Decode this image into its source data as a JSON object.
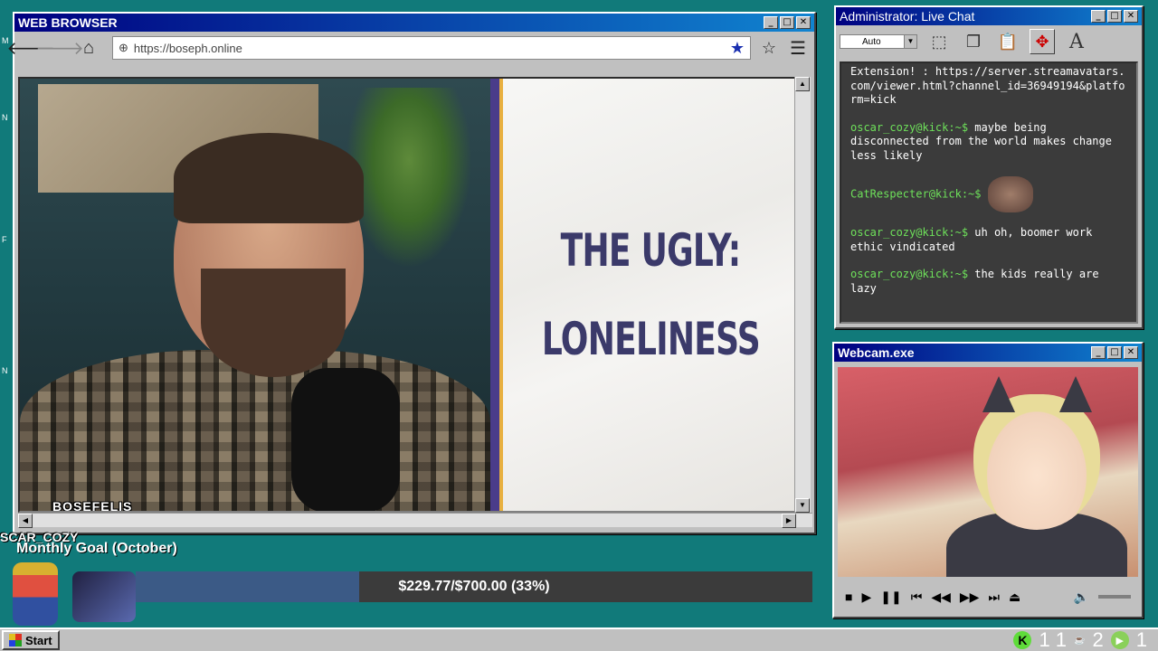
{
  "browser": {
    "title": "WEB BROWSER",
    "url": "https://boseph.online",
    "video": {
      "slide_line1": "THE UGLY:",
      "slide_line2": "LONELINESS",
      "overlay_name": "BOSEFELIS"
    }
  },
  "chat": {
    "title": "Administrator: Live Chat",
    "font_select": "Auto",
    "messages": [
      {
        "user": "",
        "text": "Extension! : https://server.streamavatars.com/viewer.html?channel_id=36949194&platform=kick"
      },
      {
        "user": "oscar_cozy@kick:~$",
        "text": "maybe being disconnected from the world makes change less likely"
      },
      {
        "user": "CatRespecter@kick:~$",
        "text": "",
        "emote": true
      },
      {
        "user": "oscar_cozy@kick:~$",
        "text": "uh oh, boomer work ethic vindicated"
      },
      {
        "user": "oscar_cozy@kick:~$",
        "text": "the kids really are lazy"
      }
    ]
  },
  "webcam": {
    "title": "Webcam.exe"
  },
  "goal": {
    "user_tag": "SCAR_COZY",
    "title": "Monthly Goal (October)",
    "text": "$229.77/$700.00 (33%)",
    "progress": 0.33
  },
  "taskbar": {
    "start_label": "Start",
    "tray_count1": "1 1",
    "tray_count2": "2",
    "tray_count3": "1"
  },
  "colors": {
    "desktop": "#117a7a",
    "title_gradient_start": "#000080",
    "chat_user": "#6ee05a",
    "goal_fill": "#3b5a86"
  }
}
